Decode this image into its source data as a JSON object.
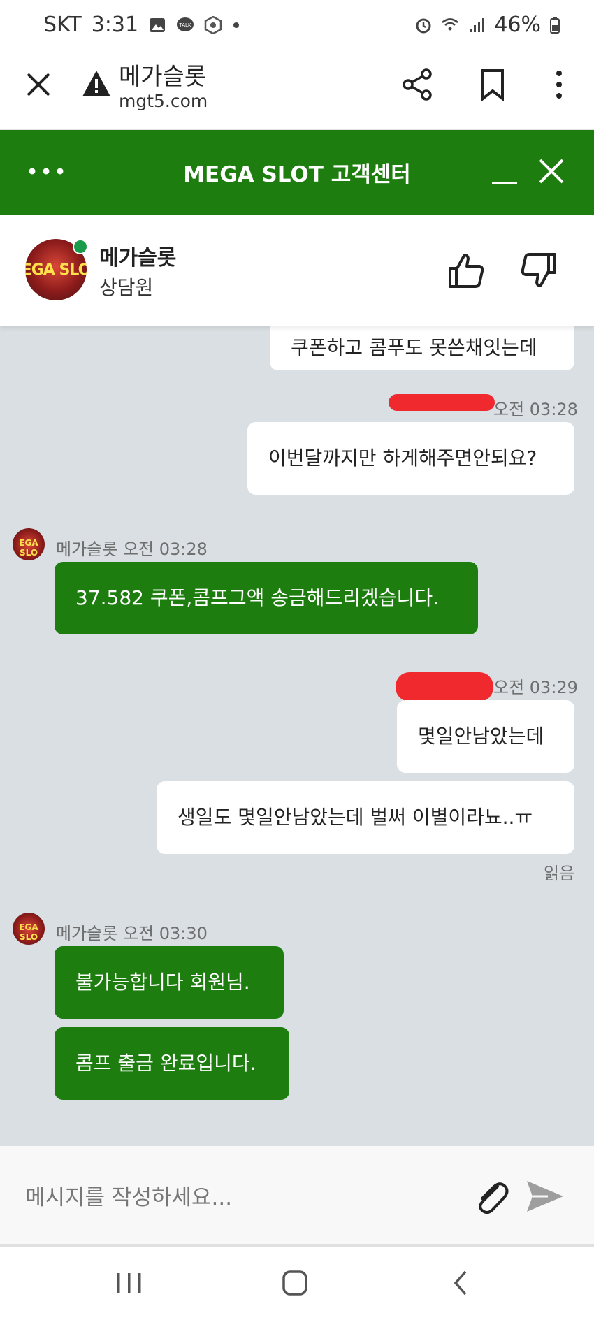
{
  "status_bar": {
    "carrier": "SKT",
    "time": "3:31",
    "battery": "46%"
  },
  "browser": {
    "page_title": "메가슬롯",
    "url": "mgt5.com"
  },
  "chat_header": {
    "title": "MEGA SLOT 고객센터"
  },
  "agent": {
    "avatar_text": "EGA SLO",
    "name": "메가슬롯",
    "role": "상담원"
  },
  "messages": [
    {
      "from": "user",
      "text": "쿠폰하고 콤푸도 못쓴채잇는데"
    },
    {
      "from": "user",
      "time": "오전 03:28",
      "text": "이번달까지만 하게해주면안되요?"
    },
    {
      "from": "agent",
      "sender": "메가슬롯",
      "time": "오전 03:28",
      "text": "37.582 쿠폰,콤프그액 송금해드리겠습니다."
    },
    {
      "from": "user",
      "time": "오전 03:29",
      "text": "몇일안남았는데"
    },
    {
      "from": "user",
      "text": "생일도 몇일안남았는데 벌써 이별이라뇨..ㅠ",
      "status": "읽음"
    },
    {
      "from": "agent",
      "sender": "메가슬롯",
      "time": "오전 03:30",
      "text": "불가능합니다 회원님."
    },
    {
      "from": "agent",
      "text": "콤프 출금 완료입니다."
    }
  ],
  "composer": {
    "placeholder": "메시지를 작성하세요..."
  },
  "colors": {
    "brand_green": "#1d7d0f",
    "chat_background": "#d9dfe2",
    "redaction": "#f0292e"
  },
  "icons": [
    "close-icon",
    "warning-icon",
    "share-icon",
    "bookmark-icon",
    "more-vert-icon",
    "more-horiz-icon",
    "minimize-icon",
    "thumbs-up-icon",
    "thumbs-down-icon",
    "paperclip-icon",
    "send-icon",
    "recents-icon",
    "home-icon",
    "back-icon"
  ]
}
